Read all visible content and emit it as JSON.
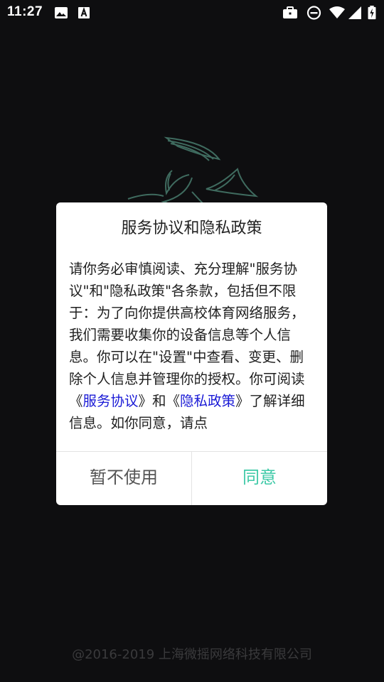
{
  "status_bar": {
    "time": "11:27",
    "left_icons": [
      "image-icon",
      "text-a-icon"
    ],
    "right_icons": [
      "briefcase-icon",
      "do-not-disturb-icon",
      "wifi-icon",
      "signal-icon",
      "battery-charging-icon"
    ]
  },
  "dialog": {
    "title": "服务协议和隐私政策",
    "body_parts": [
      "请你务必审慎阅读、充分理解\"服务协议\"和\"隐私政策\"各条款，包括但不限于：为了向你提供高校体育网络服务，我们需要收集你的设备信息等个人信息。你可以在\"设置\"中查看、变更、删除个人信息并管理你的授权。你可阅读《",
      "服务协议",
      "》和《",
      "隐私政策",
      "》了解详细信息。如你同意，请点"
    ],
    "decline_label": "暂不使用",
    "agree_label": "同意",
    "colors": {
      "link": "#1a1ad6",
      "agree": "#3ec9a7"
    }
  },
  "footer": {
    "copyright": "@2016-2019 上海微摇网络科技有限公司"
  }
}
